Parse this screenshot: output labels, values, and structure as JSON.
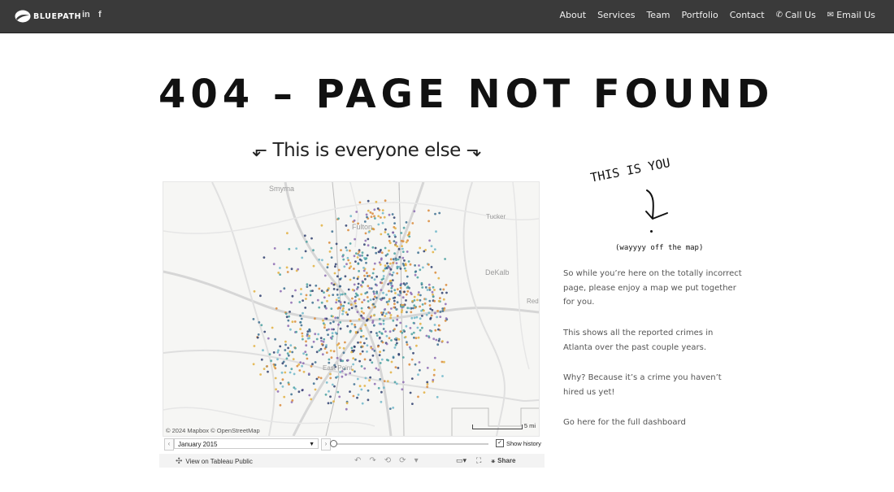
{
  "header": {
    "brand": "BLUEPATH",
    "social": [
      {
        "name": "linkedin-icon",
        "label": "in"
      },
      {
        "name": "facebook-icon",
        "label": "f"
      }
    ],
    "nav": [
      {
        "id": "about",
        "label": "About"
      },
      {
        "id": "services",
        "label": "Services"
      },
      {
        "id": "team",
        "label": "Team"
      },
      {
        "id": "portfolio",
        "label": "Portfolio"
      },
      {
        "id": "contact",
        "label": "Contact"
      },
      {
        "id": "call",
        "label": "Call Us",
        "icon": "phone-icon"
      },
      {
        "id": "email",
        "label": "Email Us",
        "icon": "envelope-icon"
      }
    ],
    "colors": {
      "bar": "#3a3a3a",
      "text": "#ffffff"
    }
  },
  "main": {
    "title": "404 – PAGE NOT FOUND",
    "subtitle": "⬐ This is everyone else ⬎"
  },
  "map": {
    "places": [
      "Smyrna",
      "Fulton",
      "Tucker",
      "DeKalb",
      "Reda",
      "East Point"
    ],
    "attribution": "© 2024 Mapbox  © OpenStreetMap",
    "scale_label": "5 mi",
    "dot_colors": [
      "#3d6e8f",
      "#4aa0a0",
      "#e2b03f",
      "#8c6bb1",
      "#2f3f6e",
      "#6fb7c9",
      "#d98a3a"
    ],
    "controls": {
      "prev": "‹",
      "selected_month": "January 2015",
      "next": "›",
      "show_history_label": "Show history",
      "show_history_checked": true
    },
    "toolbar": {
      "view_label": "View on Tableau Public",
      "share_label": "Share"
    }
  },
  "sidebar": {
    "hand_title": "THIS IS YOU",
    "hand_note": "(wayyyy off the map)",
    "paragraphs": [
      "So while you’re here on the totally incorrect page, please enjoy a map we put together for you.",
      "This shows all the reported crimes in Atlanta over the past couple years.",
      "Why? Because it’s a crime you haven’t hired us yet!"
    ],
    "cta": {
      "prefix": "Go ",
      "link": "here",
      "suffix": " for the full dashboard"
    }
  }
}
